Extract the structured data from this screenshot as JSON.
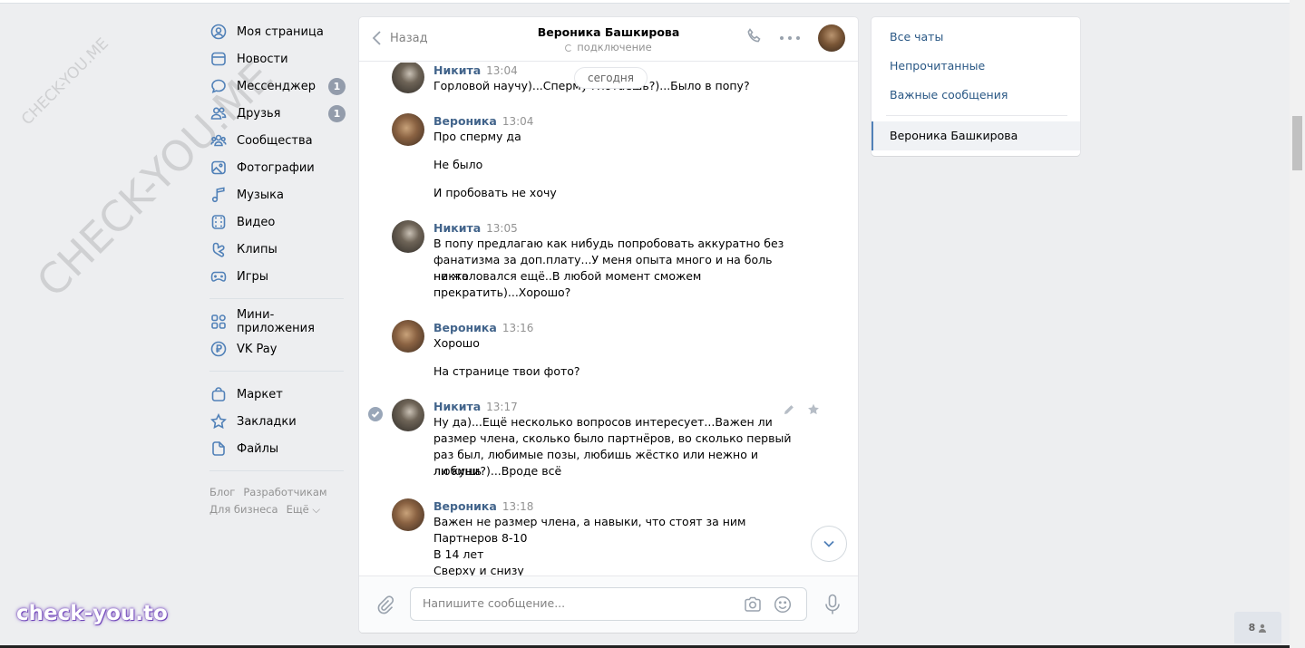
{
  "watermark": {
    "small": "CHECK-YOU.ME",
    "big": "CHECK-YOU.ME",
    "brand": "check-you.to"
  },
  "nav": {
    "items": [
      {
        "label": "Моя страница",
        "icon": "user-circle-icon"
      },
      {
        "label": "Новости",
        "icon": "news-icon"
      },
      {
        "label": "Мессенджер",
        "icon": "chat-bubble-icon",
        "badge": "1"
      },
      {
        "label": "Друзья",
        "icon": "friends-icon",
        "badge": "1"
      },
      {
        "label": "Сообщества",
        "icon": "communities-icon"
      },
      {
        "label": "Фотографии",
        "icon": "photo-icon"
      },
      {
        "label": "Музыка",
        "icon": "music-note-icon"
      },
      {
        "label": "Видео",
        "icon": "video-icon"
      },
      {
        "label": "Клипы",
        "icon": "clips-icon"
      },
      {
        "label": "Игры",
        "icon": "gamepad-icon"
      }
    ],
    "items2": [
      {
        "label": "Мини-приложения",
        "icon": "grid-apps-icon"
      },
      {
        "label": "VK Pay",
        "icon": "ruble-icon"
      }
    ],
    "items3": [
      {
        "label": "Маркет",
        "icon": "shopping-bag-icon"
      },
      {
        "label": "Закладки",
        "icon": "star-icon"
      },
      {
        "label": "Файлы",
        "icon": "file-icon"
      }
    ],
    "footer": {
      "blog": "Блог",
      "dev": "Разработчикам",
      "business": "Для бизнеса",
      "more": "Ещё ⌵"
    }
  },
  "chat": {
    "back_label": "Назад",
    "peer_name": "Вероника Башкирова",
    "peer_status": "подключение",
    "today_label": "сегодня",
    "messages": [
      {
        "author": "Никита",
        "time": "13:04",
        "lines": [
          "Горловой научу)...Сперму глотаешь?)...Было в попу?"
        ]
      },
      {
        "author": "Вероника",
        "time": "13:04",
        "lines": [
          "Про сперму да",
          "Не было",
          "И пробовать не хочу"
        ]
      },
      {
        "author": "Никита",
        "time": "13:05",
        "lines": [
          "В попу предлагаю как нибудь попробовать аккуратно без",
          "фанатизма за доп.плату...У меня опыта много и на боль никто",
          "не жаловался ещё..В любой момент сможем",
          "прекратить)...Хорошо?"
        ]
      },
      {
        "author": "Вероника",
        "time": "13:16",
        "lines": [
          "Хорошо",
          "На странице твои фото?"
        ]
      },
      {
        "author": "Никита",
        "time": "13:17",
        "lines": [
          "Ну да)...Ещё несколько вопросов интересует...Важен ли",
          "размер члена, сколько было партнёров, во сколько первый",
          "раз был, любимые позы, любишь жёстко или нежно и любишь",
          "ли куни?)...Вроде всё"
        ]
      },
      {
        "author": "Вероника",
        "time": "13:18",
        "lines": [
          "Важен не размер члена, а навыки, что стоят за ним",
          "Партнеров 8-10",
          "В 14 лет",
          "Сверху и снизу"
        ]
      }
    ],
    "composer_placeholder": "Напишите сообщение..."
  },
  "right_panel": {
    "all_chats": "Все чаты",
    "unread": "Непрочитанные",
    "important": "Важные сообщения",
    "active_chat": "Вероника Башкирова"
  },
  "online_count": "8"
}
